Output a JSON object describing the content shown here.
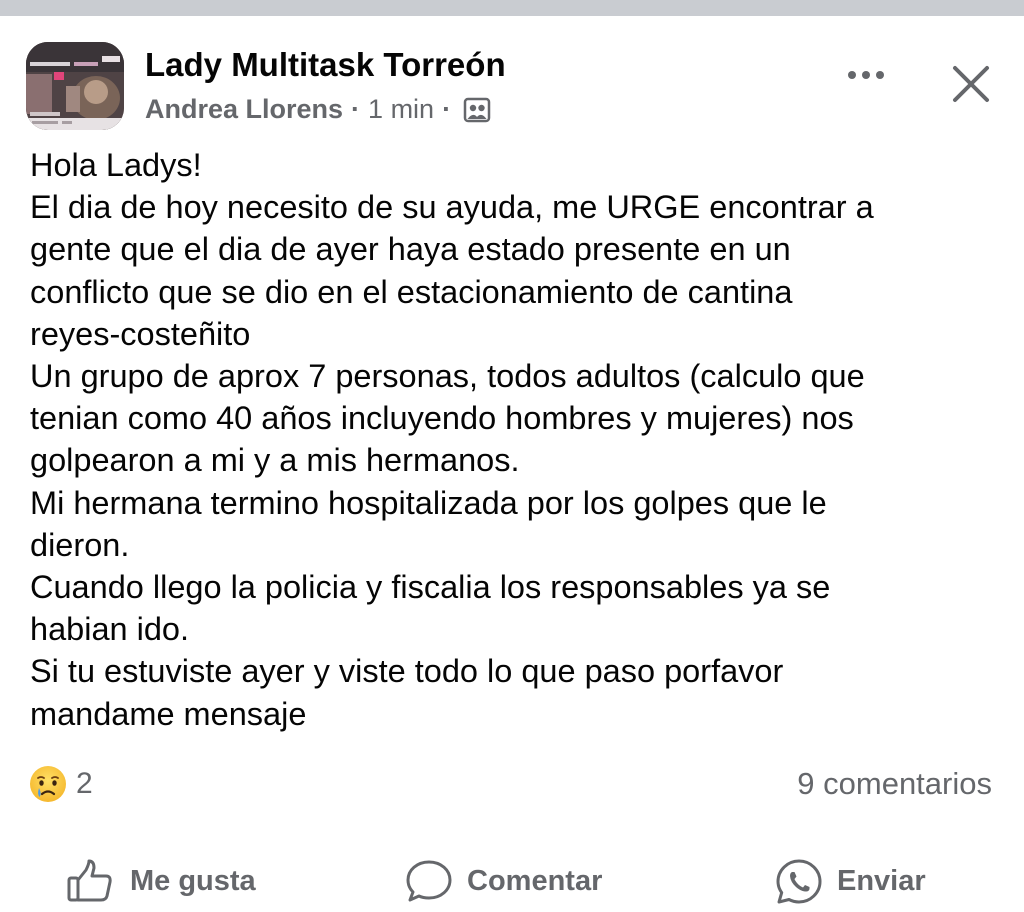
{
  "post": {
    "group_name": "Lady Multitask Torreón",
    "author": "Andrea Llorens",
    "separator": "·",
    "time": "1 min",
    "audience_icon": "group-audience-icon",
    "more_icon": "more-horizontal-icon",
    "close_icon": "close-icon",
    "body_lines": [
      "Hola Ladys!",
      "El dia de hoy necesito de su ayuda, me URGE encontrar a",
      "gente que el dia de ayer haya estado presente en un",
      "conflicto que se dio en el estacionamiento de cantina",
      "reyes-costeñito",
      "Un grupo de aprox 7 personas, todos adultos (calculo que",
      "tenian como 40 años incluyendo hombres y mujeres) nos",
      "golpearon a mi y a mis hermanos.",
      "Mi hermana termino hospitalizada por los golpes que le",
      "dieron.",
      "Cuando llego la policia y fiscalia los responsables ya se",
      "habian ido.",
      "Si tu estuviste ayer y viste todo lo que paso porfavor",
      "mandame mensaje"
    ]
  },
  "reactions": {
    "icon": "sad-reaction-icon",
    "count": "2"
  },
  "comments": {
    "label": "9 comentarios"
  },
  "actions": {
    "like_label": "Me gusta",
    "comment_label": "Comentar",
    "share_label": "Enviar"
  },
  "colors": {
    "text_primary": "#050505",
    "text_secondary": "#65676b",
    "top_bar": "#c9ccd1"
  }
}
